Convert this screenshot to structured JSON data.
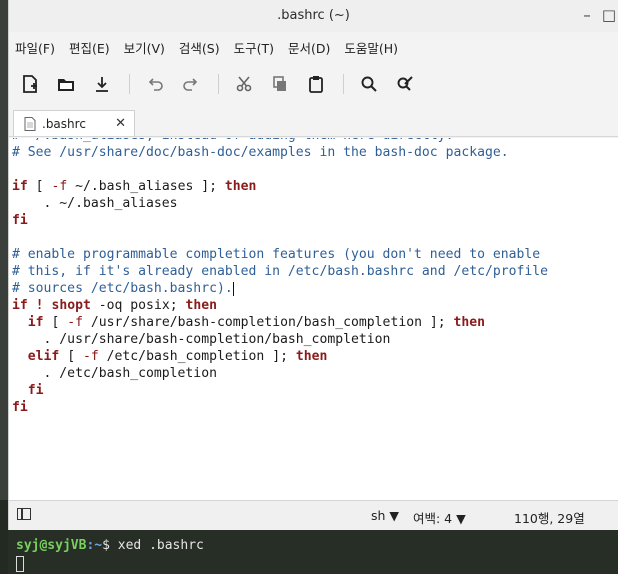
{
  "window": {
    "title": ".bashrc (~)"
  },
  "menu": [
    "파일(F)",
    "편집(E)",
    "보기(V)",
    "검색(S)",
    "도구(T)",
    "문서(D)",
    "도움말(H)"
  ],
  "tab": {
    "label": ".bashrc",
    "close": "✕"
  },
  "editor": {
    "lines": [
      [
        [
          "c",
          "# ~/.bash_aliases, instead of adding them here directly."
        ]
      ],
      [
        [
          "c",
          "# See /usr/share/doc/bash-doc/examples in the bash-doc package."
        ]
      ],
      [
        [
          "t",
          ""
        ]
      ],
      [
        [
          "k",
          "if"
        ],
        [
          "t",
          " [ "
        ],
        [
          "o",
          "-f"
        ],
        [
          "t",
          " ~/.bash_aliases ]; "
        ],
        [
          "k",
          "then"
        ]
      ],
      [
        [
          "t",
          "    . ~/.bash_aliases"
        ]
      ],
      [
        [
          "k",
          "fi"
        ]
      ],
      [
        [
          "t",
          ""
        ]
      ],
      [
        [
          "c",
          "# enable programmable completion features (you don't need to enable"
        ]
      ],
      [
        [
          "c",
          "# this, if it's already enabled in /etc/bash.bashrc and /etc/profile"
        ]
      ],
      [
        [
          "c",
          "# sources /etc/bash.bashrc)."
        ],
        [
          "cursor",
          ""
        ]
      ],
      [
        [
          "k",
          "if"
        ],
        [
          "t",
          " "
        ],
        [
          "k",
          "!"
        ],
        [
          "t",
          " "
        ],
        [
          "k",
          "shopt"
        ],
        [
          "t",
          " -oq posix; "
        ],
        [
          "k",
          "then"
        ]
      ],
      [
        [
          "t",
          "  "
        ],
        [
          "k",
          "if"
        ],
        [
          "t",
          " [ "
        ],
        [
          "o",
          "-f"
        ],
        [
          "t",
          " /usr/share/bash-completion/bash_completion ]; "
        ],
        [
          "k",
          "then"
        ]
      ],
      [
        [
          "t",
          "    . /usr/share/bash-completion/bash_completion"
        ]
      ],
      [
        [
          "t",
          "  "
        ],
        [
          "k",
          "elif"
        ],
        [
          "t",
          " [ "
        ],
        [
          "o",
          "-f"
        ],
        [
          "t",
          " /etc/bash_completion ]; "
        ],
        [
          "k",
          "then"
        ]
      ],
      [
        [
          "t",
          "    . /etc/bash_completion"
        ]
      ],
      [
        [
          "t",
          "  "
        ],
        [
          "k",
          "fi"
        ]
      ],
      [
        [
          "k",
          "fi"
        ]
      ]
    ]
  },
  "status": {
    "language": "sh",
    "tab_width": "여백: 4",
    "position": "110행, 29열"
  },
  "terminal": {
    "user_host": "syj@syjVB",
    "path": ":~",
    "prompt": "$ ",
    "command": "xed .bashrc"
  },
  "colors": {
    "comment": "#2f5f96",
    "keyword": "#8b1a1a",
    "terminal_bg": "#262e26"
  }
}
